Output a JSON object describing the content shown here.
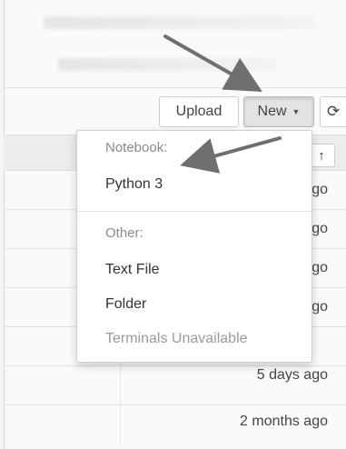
{
  "toolbar": {
    "upload_label": "Upload",
    "new_label": "New",
    "refresh_icon": "refresh-icon",
    "sort_icon": "arrow-up-icon"
  },
  "new_menu": {
    "notebook_header": "Notebook:",
    "python_item": "Python 3",
    "other_header": "Other:",
    "text_file_item": "Text File",
    "folder_item": "Folder",
    "terminals_item": "Terminals Unavailable"
  },
  "rows": [
    {
      "modified": "ago"
    },
    {
      "modified": "go"
    },
    {
      "modified": "go"
    },
    {
      "modified": "go"
    },
    {
      "modified": "5 days ago"
    },
    {
      "modified": "2 months ago"
    }
  ],
  "colors": {
    "annotation_arrow": "#6f6f6f",
    "new_button_active_bg": "#e3e3e3"
  }
}
